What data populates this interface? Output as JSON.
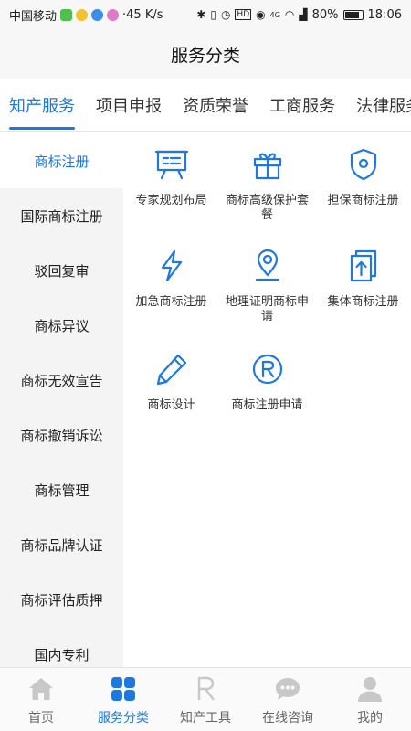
{
  "status_bar": {
    "carrier": "中国移动",
    "speed": "·45 K/s",
    "battery": "80%",
    "time": "18:06",
    "network_badge": "HD",
    "signal_badge": "4G"
  },
  "header": {
    "title": "服务分类"
  },
  "top_tabs": [
    {
      "label": "知产服务",
      "active": true
    },
    {
      "label": "项目申报",
      "active": false
    },
    {
      "label": "资质荣誉",
      "active": false
    },
    {
      "label": "工商服务",
      "active": false
    },
    {
      "label": "法律服务",
      "active": false
    }
  ],
  "sidebar": {
    "items": [
      {
        "label": "商标注册",
        "active": true
      },
      {
        "label": "国际商标注册",
        "active": false
      },
      {
        "label": "驳回复审",
        "active": false
      },
      {
        "label": "商标异议",
        "active": false
      },
      {
        "label": "商标无效宣告",
        "active": false
      },
      {
        "label": "商标撤销诉讼",
        "active": false
      },
      {
        "label": "商标管理",
        "active": false
      },
      {
        "label": "商标品牌认证",
        "active": false
      },
      {
        "label": "商标评估质押",
        "active": false
      },
      {
        "label": "国内专利",
        "active": false
      }
    ]
  },
  "grid": {
    "items": [
      {
        "label": "专家规划布局",
        "icon": "presentation-board-icon"
      },
      {
        "label": "商标高级保护套餐",
        "icon": "gift-icon"
      },
      {
        "label": "担保商标注册",
        "icon": "shield-icon"
      },
      {
        "label": "加急商标注册",
        "icon": "lightning-icon"
      },
      {
        "label": "地理证明商标申请",
        "icon": "location-pin-icon"
      },
      {
        "label": "集体商标注册",
        "icon": "document-upload-icon"
      },
      {
        "label": "商标设计",
        "icon": "pencil-icon"
      },
      {
        "label": "商标注册申请",
        "icon": "registered-mark-icon"
      }
    ]
  },
  "bottom_nav": {
    "items": [
      {
        "label": "首页",
        "icon": "home-icon",
        "active": false
      },
      {
        "label": "服务分类",
        "icon": "grid-icon",
        "active": true
      },
      {
        "label": "知产工具",
        "icon": "r-letter-icon",
        "active": false
      },
      {
        "label": "在线咨询",
        "icon": "chat-bubble-icon",
        "active": false
      },
      {
        "label": "我的",
        "icon": "user-icon",
        "active": false
      }
    ]
  },
  "colors": {
    "accent": "#1e78e0",
    "inactive_icon": "#c8c8c8",
    "text": "#333333"
  }
}
